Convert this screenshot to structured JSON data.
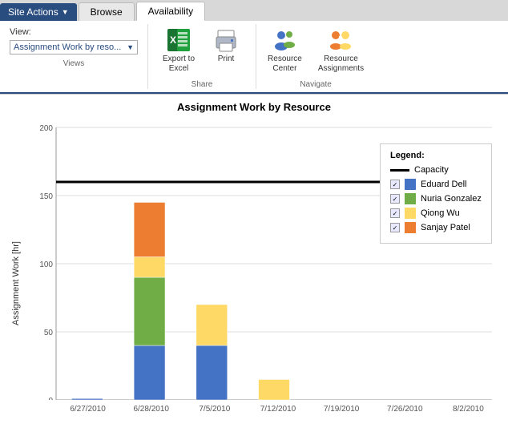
{
  "tabs": {
    "site_actions": "Site Actions",
    "browse": "Browse",
    "availability": "Availability"
  },
  "ribbon": {
    "view_label": "View:",
    "view_value": "Assignment Work by reso...",
    "views_group": "Views",
    "share_group": "Share",
    "navigate_group": "Navigate",
    "export_label": "Export to\nExcel",
    "print_label": "Print",
    "resource_center_label": "Resource\nCenter",
    "resource_assignments_label": "Resource\nAssignments"
  },
  "chart": {
    "title": "Assignment Work by Resource",
    "y_axis_label": "Assignment Work [hr]",
    "y_ticks": [
      "0",
      "50",
      "100",
      "150",
      "200"
    ],
    "x_ticks": [
      "6/27/2010",
      "6/28/2010",
      "7/5/2010",
      "7/12/2010",
      "7/19/2010",
      "7/26/2010",
      "8/2/2010"
    ],
    "capacity_value": 160,
    "bars": [
      {
        "date": "6/27/2010",
        "segments": [
          {
            "person": "Eduard Dell",
            "color": "#4472C4",
            "value": 1
          },
          {
            "person": "Nuria Gonzalez",
            "color": "#70AD47",
            "value": 0
          },
          {
            "person": "Qiong Wu",
            "color": "#FFD966",
            "value": 0
          },
          {
            "person": "Sanjay Patel",
            "color": "#ED7D31",
            "value": 0
          }
        ],
        "total": 1
      },
      {
        "date": "6/28/2010",
        "segments": [
          {
            "person": "Eduard Dell",
            "color": "#4472C4",
            "value": 40
          },
          {
            "person": "Nuria Gonzalez",
            "color": "#70AD47",
            "value": 50
          },
          {
            "person": "Qiong Wu",
            "color": "#FFD966",
            "value": 15
          },
          {
            "person": "Sanjay Patel",
            "color": "#ED7D31",
            "value": 40
          }
        ],
        "total": 145
      },
      {
        "date": "7/5/2010",
        "segments": [
          {
            "person": "Eduard Dell",
            "color": "#4472C4",
            "value": 40
          },
          {
            "person": "Nuria Gonzalez",
            "color": "#70AD47",
            "value": 0
          },
          {
            "person": "Qiong Wu",
            "color": "#FFD966",
            "value": 30
          },
          {
            "person": "Sanjay Patel",
            "color": "#ED7D31",
            "value": 0
          }
        ],
        "total": 70
      },
      {
        "date": "7/12/2010",
        "segments": [
          {
            "person": "Eduard Dell",
            "color": "#4472C4",
            "value": 0
          },
          {
            "person": "Nuria Gonzalez",
            "color": "#70AD47",
            "value": 0
          },
          {
            "person": "Qiong Wu",
            "color": "#FFD966",
            "value": 15
          },
          {
            "person": "Sanjay Patel",
            "color": "#ED7D31",
            "value": 0
          }
        ],
        "total": 15
      },
      {
        "date": "7/19/2010",
        "segments": [],
        "total": 0
      },
      {
        "date": "7/26/2010",
        "segments": [],
        "total": 0
      },
      {
        "date": "8/2/2010",
        "segments": [],
        "total": 0
      }
    ],
    "legend": {
      "title": "Legend:",
      "capacity_label": "Capacity",
      "items": [
        {
          "name": "Eduard Dell",
          "color": "#4472C4"
        },
        {
          "name": "Nuria Gonzalez",
          "color": "#70AD47"
        },
        {
          "name": "Qiong Wu",
          "color": "#FFD966"
        },
        {
          "name": "Sanjay Patel",
          "color": "#ED7D31"
        }
      ]
    }
  }
}
